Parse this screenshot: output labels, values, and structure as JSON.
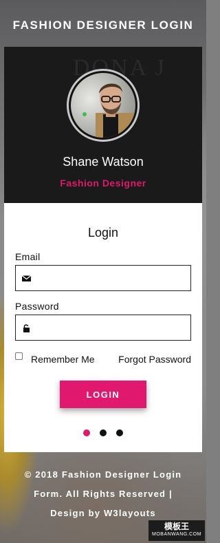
{
  "page": {
    "title": "FASHION DESIGNER LOGIN"
  },
  "profile": {
    "name": "Shane Watson",
    "role": "Fashion Designer",
    "header_background_text": "DONA J"
  },
  "login": {
    "heading": "Login",
    "email_label": "Email",
    "email_value": "",
    "password_label": "Password",
    "password_value": "",
    "remember_label": "Remember Me",
    "remember_checked": false,
    "forgot_label": "Forgot Password",
    "submit_label": "LOGIN"
  },
  "carousel": {
    "total_slides": 3,
    "active_slide": 1
  },
  "footer": {
    "line1": "© 2018 Fashion Designer Login",
    "line2": "Form. All Rights Reserved |",
    "line3": "Design by W3layouts"
  },
  "watermark": {
    "label": "模板王",
    "sub": "MOBANWANG.COM"
  },
  "colors": {
    "accent": "#e0186e",
    "header_bg": "#1a1a1a",
    "card_bg": "#ffffff"
  },
  "icons": {
    "email": "envelope-icon",
    "password": "lock-icon"
  }
}
